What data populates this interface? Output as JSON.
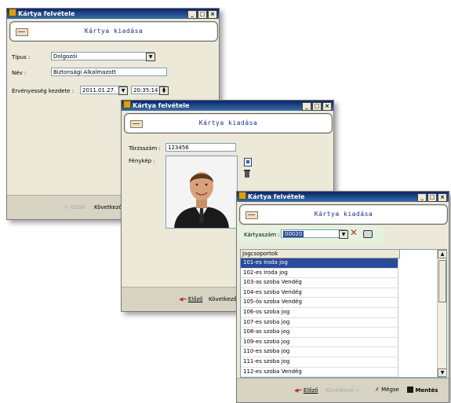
{
  "windows": {
    "w1": {
      "title": "Kártya felvétele",
      "banner": "Kártya kiadása",
      "tipus_label": "Típus :",
      "tipus_value": "Dolgozói",
      "nev_label": "Név :",
      "nev_value": "Biztonsági Alkalmazott",
      "ervenyesseg_label": "Érvényesség kezdete :",
      "date_value": "2011.01.27.",
      "time_value": "20:35:14",
      "prev_label": "Előző",
      "next_label": "Következő"
    },
    "w2": {
      "title": "Kártya felvétele",
      "banner": "Kártya kiadása",
      "torzsszam_label": "Törzsszám :",
      "torzsszam_value": "123456",
      "fenykep_label": "Fénykép :",
      "prev_label": "Előző",
      "next_label": "Következő"
    },
    "w3": {
      "title": "Kártya felvétele",
      "banner": "Kártya kiadása",
      "kartyaszam_label": "Kártyaszám :",
      "kartyaszam_value": "00020",
      "grid_header": "Jogcsoportok",
      "rows": [
        "101-es Iroda jog",
        "102-es Iroda jog",
        "103-as szoba Vendég",
        "104-es szoba Vendég",
        "105-ös szoba Vendég",
        "106-os szoba jog",
        "107-es szoba jog",
        "108-as szoba jog",
        "109-es szoba jog",
        "110-es szoba jog",
        "111-es szoba jog",
        "112-es szoba Vendég"
      ],
      "selected_row": 0,
      "prev_label": "Előző",
      "next_label": "Következő",
      "cancel_label": "Mégse",
      "save_label": "Mentés"
    }
  },
  "window_buttons": {
    "minimize": "_",
    "maximize": "□",
    "close": "×"
  },
  "colors": {
    "title_bar": "#0a246a",
    "accent_arrow": "#c0302a",
    "selection": "#2a4a9a",
    "banner_text": "#1a2d8a"
  }
}
